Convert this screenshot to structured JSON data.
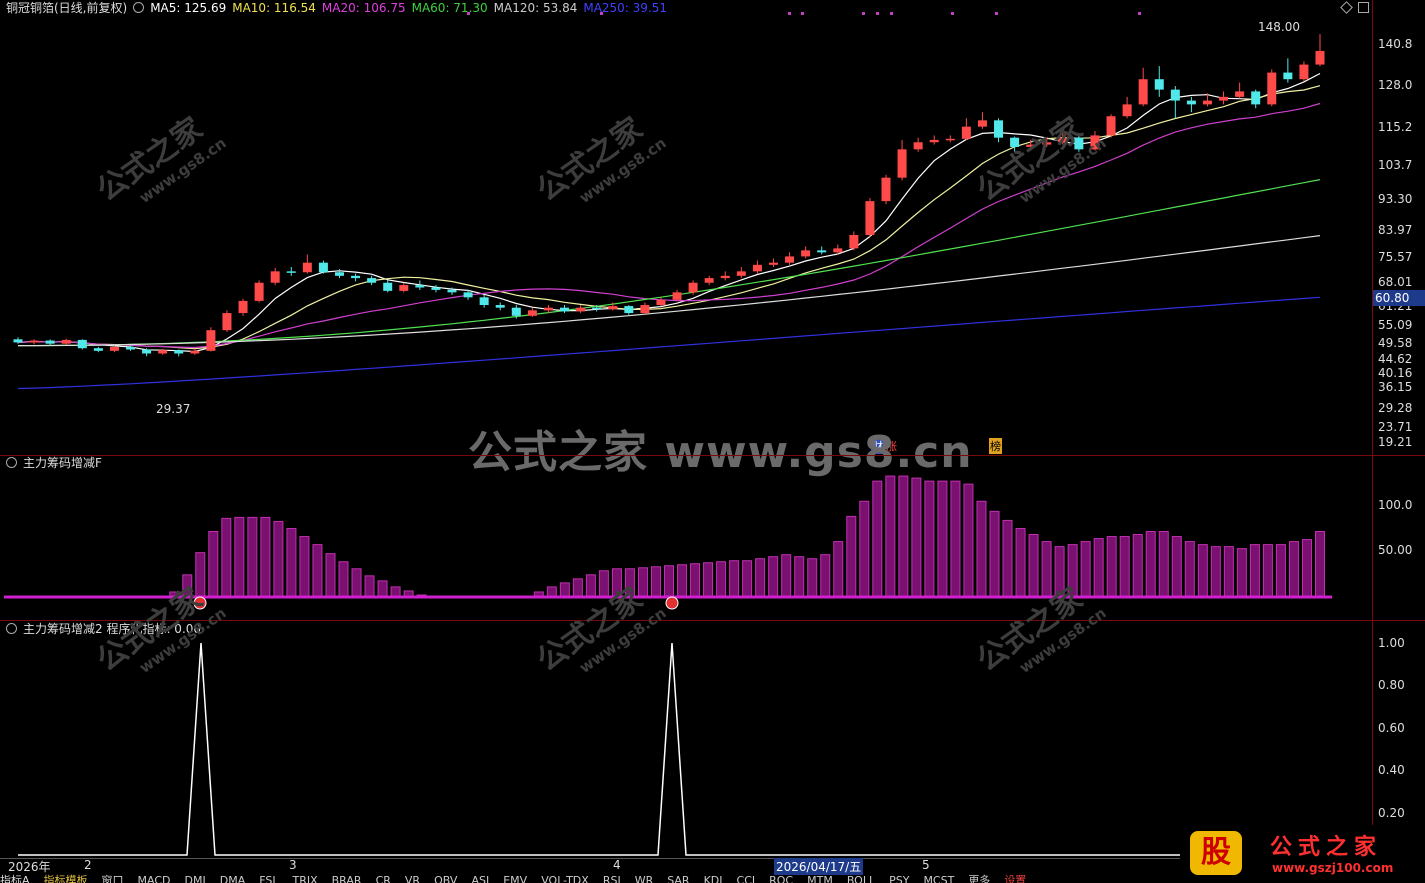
{
  "main_header": {
    "title": "铜冠铜箔(日线,前复权)",
    "ma": [
      {
        "label": "MA5: 125.69",
        "color": "#ffffff"
      },
      {
        "label": "MA10: 116.54",
        "color": "#f0e050"
      },
      {
        "label": "MA20: 106.75",
        "color": "#e040e0"
      },
      {
        "label": "MA60: 71.30",
        "color": "#40d040"
      },
      {
        "label": "MA120: 53.84",
        "color": "#cccccc"
      },
      {
        "label": "MA250: 39.51",
        "color": "#4040ff"
      }
    ]
  },
  "main_axis": [
    "140.8",
    "128.0",
    "115.2",
    "103.7",
    "93.30",
    "83.97",
    "75.57",
    "68.01",
    "61.21",
    "55.09",
    "49.58",
    "44.62",
    "40.16",
    "36.15",
    "29.28",
    "23.71",
    "19.21"
  ],
  "price_tag": "60.80",
  "annotations": {
    "high": "148.00",
    "low": "29.37"
  },
  "badges": [
    "财",
    "涨",
    "榜"
  ],
  "watermark": {
    "big": "公式之家 www.gs8.cn",
    "diag": "公式之家",
    "diag_url": "www.gs8.cn"
  },
  "panel2": {
    "title": "主力筹码增减F",
    "axis": [
      "100.0",
      "50.00"
    ]
  },
  "panel3": {
    "title": "主力筹码增减2 程序化指标: 0.00",
    "axis": [
      "1.00",
      "0.80",
      "0.60",
      "0.40",
      "0.20"
    ]
  },
  "date_axis": {
    "year": "2026年",
    "m2": "2",
    "m3": "3",
    "m4": "4",
    "selected": "2026/04/17/五",
    "m5": "5"
  },
  "tabs": [
    "指标A",
    "指标模板",
    "窗口",
    "MACD",
    "DMI",
    "DMA",
    "FSL",
    "TRIX",
    "BRAR",
    "CR",
    "VR",
    "OBV",
    "ASI",
    "EMV",
    "VOL-TDX",
    "RSI",
    "WR",
    "SAR",
    "KDJ",
    "CCI",
    "ROC",
    "MTM",
    "BOLL",
    "PSY",
    "MCST",
    "更多",
    "设置"
  ],
  "logo": {
    "gu": "股",
    "name": "公式之家",
    "url": "www.gszj100.com"
  },
  "chart_data": [
    {
      "type": "candlestick",
      "title": "铜冠铜箔(日线,前复权)",
      "y_scale": "log",
      "ylim": [
        19.21,
        148.0
      ],
      "candles": [
        [
          32.0,
          31.5,
          32.3,
          31.3
        ],
        [
          31.5,
          31.8,
          32.0,
          31.2
        ],
        [
          31.8,
          31.3,
          32.0,
          31.0
        ],
        [
          31.3,
          31.9,
          32.1,
          31.1
        ],
        [
          31.9,
          30.6,
          32.0,
          30.4
        ],
        [
          30.6,
          30.2,
          30.8,
          30.0
        ],
        [
          30.2,
          30.8,
          31.0,
          30.0
        ],
        [
          30.8,
          30.4,
          31.0,
          30.2
        ],
        [
          30.4,
          29.8,
          30.6,
          29.4
        ],
        [
          29.8,
          30.3,
          30.5,
          29.6
        ],
        [
          30.3,
          29.8,
          30.4,
          29.37
        ],
        [
          29.8,
          30.2,
          30.5,
          29.6
        ],
        [
          30.2,
          33.5,
          34.0,
          30.1
        ],
        [
          33.5,
          36.5,
          37.0,
          33.2
        ],
        [
          36.5,
          38.8,
          39.2,
          36.0
        ],
        [
          38.8,
          42.5,
          43.0,
          38.5
        ],
        [
          42.5,
          45.0,
          45.8,
          42.0
        ],
        [
          45.0,
          44.8,
          46.0,
          44.0
        ],
        [
          44.8,
          47.0,
          49.0,
          44.5
        ],
        [
          47.0,
          44.8,
          47.5,
          44.5
        ],
        [
          44.8,
          44.0,
          45.5,
          43.5
        ],
        [
          44.0,
          43.5,
          44.5,
          42.8
        ],
        [
          43.5,
          42.5,
          44.0,
          42.0
        ],
        [
          42.5,
          40.8,
          43.0,
          40.5
        ],
        [
          40.8,
          42.0,
          42.5,
          40.5
        ],
        [
          42.0,
          41.5,
          43.0,
          41.0
        ],
        [
          41.5,
          41.0,
          42.0,
          40.5
        ],
        [
          41.0,
          40.5,
          41.5,
          40.0
        ],
        [
          40.5,
          39.5,
          41.0,
          39.0
        ],
        [
          39.5,
          38.0,
          40.0,
          37.5
        ],
        [
          38.0,
          37.5,
          38.5,
          37.0
        ],
        [
          37.5,
          36.0,
          38.0,
          35.5
        ],
        [
          36.0,
          37.0,
          37.5,
          35.8
        ],
        [
          37.0,
          37.5,
          38.0,
          36.5
        ],
        [
          37.5,
          36.8,
          38.0,
          36.5
        ],
        [
          36.8,
          37.5,
          38.0,
          36.5
        ],
        [
          37.5,
          37.2,
          38.0,
          36.8
        ],
        [
          37.2,
          37.8,
          38.5,
          37.0
        ],
        [
          37.8,
          36.5,
          38.0,
          36.2
        ],
        [
          36.5,
          38.0,
          38.5,
          36.3
        ],
        [
          38.0,
          39.0,
          39.5,
          37.8
        ],
        [
          39.0,
          40.5,
          41.0,
          38.8
        ],
        [
          40.5,
          42.5,
          43.0,
          40.0
        ],
        [
          42.5,
          43.5,
          44.0,
          42.0
        ],
        [
          43.5,
          44.0,
          45.0,
          43.0
        ],
        [
          44.0,
          45.0,
          46.0,
          43.5
        ],
        [
          45.0,
          46.5,
          47.5,
          44.5
        ],
        [
          46.5,
          47.0,
          48.0,
          46.0
        ],
        [
          47.0,
          48.5,
          49.5,
          46.5
        ],
        [
          48.5,
          50.0,
          51.0,
          48.0
        ],
        [
          50.0,
          49.5,
          51.0,
          49.0
        ],
        [
          49.5,
          50.5,
          51.5,
          49.0
        ],
        [
          50.5,
          54.0,
          55.0,
          50.0
        ],
        [
          54.0,
          64.0,
          65.0,
          53.5
        ],
        [
          64.0,
          72.0,
          73.0,
          63.0
        ],
        [
          72.0,
          83.0,
          87.0,
          71.0
        ],
        [
          83.0,
          86.0,
          88.0,
          82.0
        ],
        [
          86.0,
          87.0,
          89.0,
          85.0
        ],
        [
          87.0,
          87.5,
          89.0,
          86.0
        ],
        [
          87.5,
          93.0,
          97.0,
          87.0
        ],
        [
          93.0,
          96.0,
          100.0,
          92.0
        ],
        [
          96.0,
          88.0,
          97.0,
          86.0
        ],
        [
          88.0,
          84.0,
          88.5,
          82.0
        ],
        [
          84.0,
          85.0,
          87.0,
          83.0
        ],
        [
          85.0,
          86.0,
          88.0,
          84.0
        ],
        [
          86.0,
          88.0,
          90.0,
          85.0
        ],
        [
          88.0,
          83.0,
          89.0,
          82.0
        ],
        [
          83.0,
          89.0,
          91.0,
          82.5
        ],
        [
          89.0,
          98.0,
          99.0,
          88.0
        ],
        [
          98.0,
          104.0,
          108.0,
          97.0
        ],
        [
          104.0,
          118.0,
          125.0,
          103.0
        ],
        [
          118.0,
          112.0,
          126.0,
          108.0
        ],
        [
          112.0,
          106.0,
          114.0,
          97.0
        ],
        [
          106.0,
          104.0,
          108.0,
          100.0
        ],
        [
          104.0,
          106.0,
          110.0,
          103.0
        ],
        [
          106.0,
          108.0,
          111.0,
          104.0
        ],
        [
          108.0,
          111.0,
          116.0,
          107.0
        ],
        [
          111.0,
          104.0,
          112.0,
          102.0
        ],
        [
          104.0,
          122.0,
          124.0,
          103.0
        ],
        [
          122.0,
          118.0,
          131.0,
          116.0
        ],
        [
          118.0,
          127.0,
          129.0,
          117.0
        ],
        [
          127.0,
          136.0,
          148.0,
          126.0
        ]
      ],
      "ma": {
        "MA5": 125.69,
        "MA10": 116.54,
        "MA20": 106.75,
        "MA60": 71.3,
        "MA120": 53.84,
        "MA250": 39.51
      }
    },
    {
      "type": "bar",
      "title": "主力筹码增减F",
      "ylim": [
        0,
        130
      ],
      "values": [
        0,
        0,
        0,
        0,
        0,
        0,
        0,
        0,
        0,
        0,
        0,
        0,
        5,
        22,
        44,
        65,
        78,
        79,
        79,
        79,
        75,
        68,
        60,
        52,
        43,
        35,
        28,
        21,
        16,
        10,
        6,
        2,
        1,
        0,
        0,
        0,
        0,
        0,
        0,
        0,
        5,
        10,
        14,
        18,
        22,
        26,
        28,
        28,
        29,
        30,
        31,
        32,
        33,
        34,
        35,
        36,
        36,
        38,
        40,
        42,
        40,
        38,
        42,
        55,
        80,
        95,
        115,
        120,
        120,
        118,
        115,
        115,
        115,
        112,
        95,
        85,
        76,
        68,
        62,
        55,
        50,
        52,
        55,
        58,
        60,
        60,
        62,
        65,
        65,
        60,
        55,
        52,
        50,
        50,
        48,
        52,
        52,
        52,
        55,
        57,
        65
      ]
    },
    {
      "type": "line",
      "title": "主力筹码增减2 程序化指标: 0.00",
      "ylim": [
        0,
        1.05
      ],
      "spikes_at": [
        13,
        44
      ],
      "values_note": "0 except spikes to 1.00"
    }
  ]
}
